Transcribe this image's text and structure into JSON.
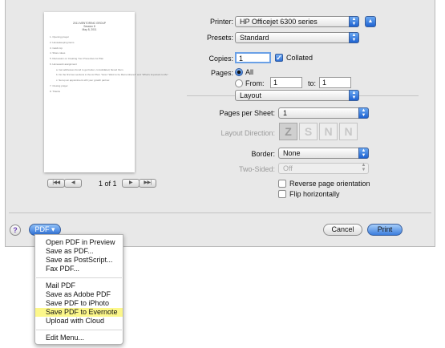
{
  "preview": {
    "doc_title_lines": [
      "2011 MENTORING GROUP",
      "Session 8",
      "May 8, 2011"
    ],
    "doc_items": [
      {
        "text": "1. Opening prayer",
        "sub": false
      },
      {
        "text": "2. Housekeeping items",
        "sub": false
      },
      {
        "text": "3. Catch-Up",
        "sub": false
      },
      {
        "text": "4. Share ideas",
        "sub": false
      },
      {
        "text": "5. Discussion on Creating Your Preventive Ax Plan",
        "sub": false
      },
      {
        "text": "6. Homework assignment",
        "sub": false
      },
      {
        "text": "a. Get addresses found to get better, consolidated, flexed them.",
        "sub": true
      },
      {
        "text": "b. Do the first two sections in the Ax Plan: \"How I Want to be Remembered\" and \"What's Important to Me\"",
        "sub": true
      },
      {
        "text": "c. Set up an appointment with your growth partner.",
        "sub": true
      },
      {
        "text": "7. Closing prayer",
        "sub": false
      },
      {
        "text": "8. Thanks",
        "sub": false
      }
    ],
    "first_label": "|◀◀",
    "prev_label": "◀",
    "next_label": "▶",
    "last_label": "▶▶|",
    "page_count": "1 of 1"
  },
  "form": {
    "printer_label": "Printer:",
    "printer_value": "HP Officejet 6300 series",
    "expand_label": "▲",
    "presets_label": "Presets:",
    "presets_value": "Standard",
    "copies_label": "Copies:",
    "copies_value": "1",
    "collated_label": "Collated",
    "pages_label": "Pages:",
    "pages_all_label": "All",
    "pages_from_label": "From:",
    "pages_from_value": "1",
    "pages_to_label": "to:",
    "pages_to_value": "1",
    "section_value": "Layout",
    "pps_label": "Pages per Sheet:",
    "pps_value": "1",
    "layout_dir_label": "Layout Direction:",
    "layout_dir_glyphs": [
      "Z",
      "S",
      "N",
      "N"
    ],
    "border_label": "Border:",
    "border_value": "None",
    "two_sided_label": "Two-Sided:",
    "two_sided_value": "Off",
    "reverse_label": "Reverse page orientation",
    "flip_label": "Flip horizontally"
  },
  "bottom": {
    "help_label": "?",
    "pdf_label": "PDF ▾",
    "cancel_label": "Cancel",
    "print_label": "Print"
  },
  "pdf_menu": {
    "group1": [
      "Open PDF in Preview",
      "Save as PDF...",
      "Save as PostScript...",
      "Fax PDF..."
    ],
    "group2": [
      "Mail PDF",
      "Save as Adobe PDF",
      "Save PDF to iPhoto",
      "Save PDF to Evernote",
      "Upload with Cloud"
    ],
    "group3": [
      "Edit Menu..."
    ],
    "highlighted": "Save PDF to Evernote"
  },
  "colors": {
    "accent": "#2e70d6",
    "highlight": "#fcf78a"
  }
}
